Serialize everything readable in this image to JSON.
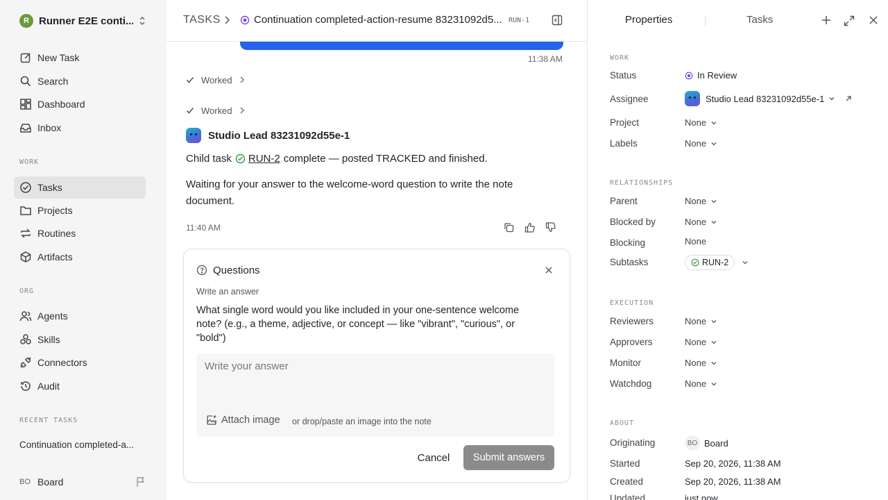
{
  "sidebar": {
    "workspace": {
      "logo": "R",
      "name": "Runner E2E conti..."
    },
    "top_items": [
      {
        "label": "New Task",
        "icon": "compose-icon"
      },
      {
        "label": "Search",
        "icon": "search-icon"
      },
      {
        "label": "Dashboard",
        "icon": "dashboard-icon"
      },
      {
        "label": "Inbox",
        "icon": "inbox-icon"
      }
    ],
    "work_label": "WORK",
    "work_items": [
      {
        "label": "Tasks",
        "icon": "check-circle-icon",
        "active": true
      },
      {
        "label": "Projects",
        "icon": "folder-icon"
      },
      {
        "label": "Routines",
        "icon": "repeat-icon"
      },
      {
        "label": "Artifacts",
        "icon": "box-icon"
      }
    ],
    "org_label": "ORG",
    "org_items": [
      {
        "label": "Agents",
        "icon": "users-icon"
      },
      {
        "label": "Skills",
        "icon": "skills-icon"
      },
      {
        "label": "Connectors",
        "icon": "plug-icon"
      },
      {
        "label": "Audit",
        "icon": "history-icon"
      }
    ],
    "recent_label": "RECENT TASKS",
    "recent_items": [
      {
        "label": "Continuation completed-a..."
      }
    ],
    "user": {
      "initials": "BO",
      "name": "Board"
    }
  },
  "header": {
    "root": "TASKS",
    "title": "Continuation completed-action-resume 83231092d5...",
    "task_id": "RUN-1"
  },
  "thread": {
    "prev_time": "11:38 AM",
    "worked_label": "Worked",
    "agent_name": "Studio Lead 83231092d55e-1",
    "msg1_prefix": "Child task",
    "msg1_link": "RUN-2",
    "msg1_suffix": "complete — posted TRACKED and finished.",
    "msg2": "Waiting for your answer to the welcome-word question to write the note document.",
    "time": "11:40 AM"
  },
  "questions": {
    "title": "Questions",
    "label": "Write an answer",
    "question": "What single word would you like included in your one-sentence welcome note? (e.g., a theme, adjective, or concept — like \"vibrant\", \"curious\", or \"bold\")",
    "placeholder": "Write your answer",
    "attach_label": "Attach image",
    "drop_hint": "or drop/paste an image into the note",
    "cancel_label": "Cancel",
    "submit_label": "Submit answers"
  },
  "panel": {
    "tabs": [
      {
        "label": "Properties",
        "active": true
      },
      {
        "label": "Tasks",
        "active": false
      }
    ],
    "work_label": "WORK",
    "status_label": "Status",
    "status_value": "In Review",
    "assignee_label": "Assignee",
    "assignee_value": "Studio Lead 83231092d55e-1",
    "project_label": "Project",
    "project_value": "None",
    "labels_label": "Labels",
    "labels_value": "None",
    "relationships_label": "RELATIONSHIPS",
    "parent_label": "Parent",
    "parent_value": "None",
    "blocked_by_label": "Blocked by",
    "blocked_by_value": "None",
    "blocking_label": "Blocking",
    "blocking_value": "None",
    "subtasks_label": "Subtasks",
    "subtasks_value": "RUN-2",
    "execution_label": "EXECUTION",
    "reviewers_label": "Reviewers",
    "reviewers_value": "None",
    "approvers_label": "Approvers",
    "approvers_value": "None",
    "monitor_label": "Monitor",
    "monitor_value": "None",
    "watchdog_label": "Watchdog",
    "watchdog_value": "None",
    "about_label": "ABOUT",
    "originating_label": "Originating",
    "originating_initials": "BO",
    "originating_value": "Board",
    "started_label": "Started",
    "started_value": "Sep 20, 2026, 11:38 AM",
    "created_label": "Created",
    "created_value": "Sep 20, 2026, 11:38 AM",
    "updated_label": "Updated",
    "updated_value": "just now"
  },
  "colors": {
    "accent": "#2463eb",
    "status_review": "#7c4ddb",
    "success": "#2f9e44",
    "submit_disabled": "#8b8b8b"
  }
}
